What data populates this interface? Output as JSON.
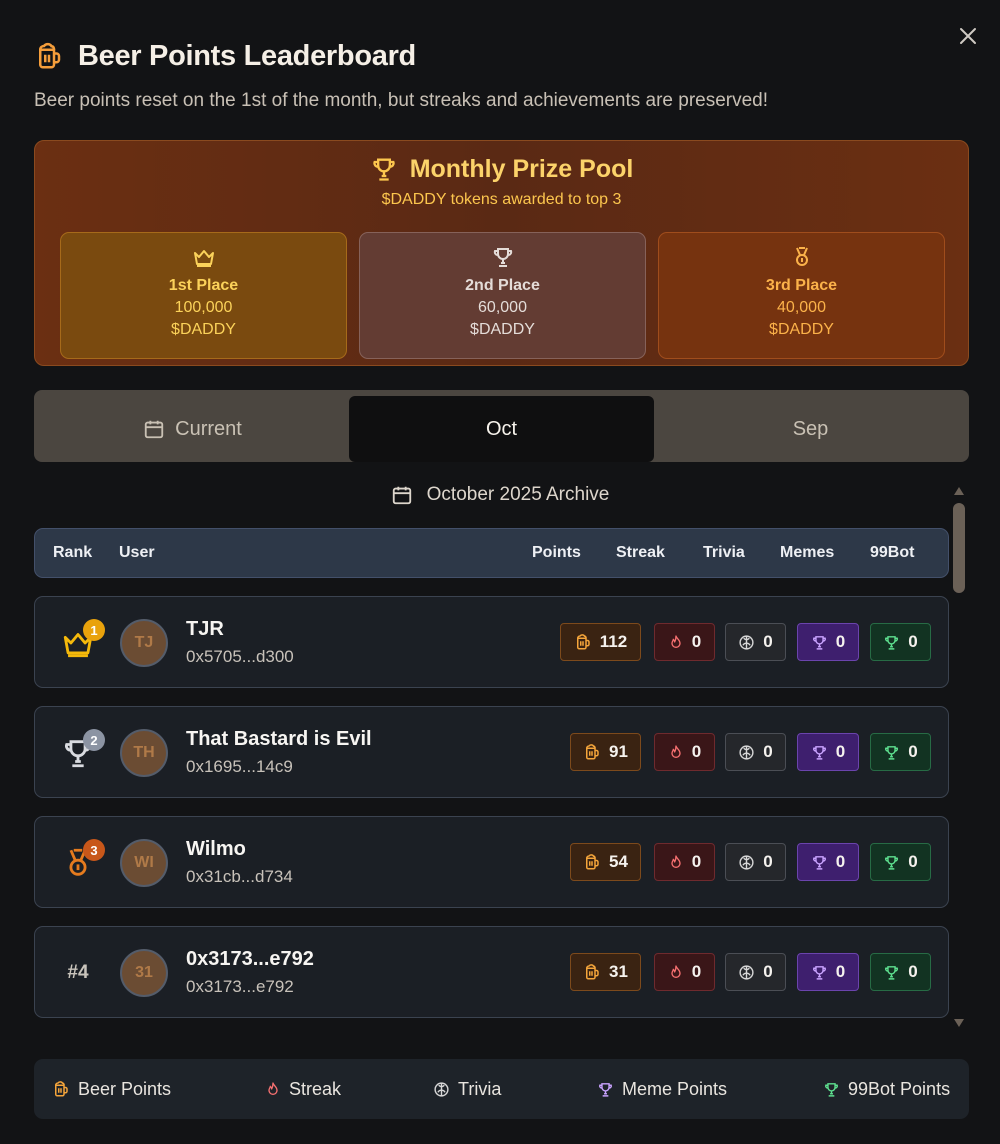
{
  "header": {
    "title": "Beer Points Leaderboard",
    "subtitle": "Beer points reset on the 1st of the month, but streaks and achievements are preserved!"
  },
  "prize_pool": {
    "title": "Monthly Prize Pool",
    "subtitle": "$DADDY tokens awarded to top 3",
    "places": [
      {
        "label": "1st Place",
        "amount": "100,000",
        "token": "$DADDY",
        "icon": "crown-icon"
      },
      {
        "label": "2nd Place",
        "amount": "60,000",
        "token": "$DADDY",
        "icon": "trophy-icon"
      },
      {
        "label": "3rd Place",
        "amount": "40,000",
        "token": "$DADDY",
        "icon": "medal-icon"
      }
    ]
  },
  "tabs": [
    {
      "label": "Current",
      "icon": "calendar-icon"
    },
    {
      "label": "Oct",
      "active": true
    },
    {
      "label": "Sep"
    }
  ],
  "archive_label": "October 2025 Archive",
  "table": {
    "columns": [
      "Rank",
      "User",
      "Points",
      "Streak",
      "Trivia",
      "Memes",
      "99Bot"
    ],
    "rows": [
      {
        "rank": "1",
        "initials": "TJ",
        "name": "TJR",
        "address": "0x5705...d300",
        "points": "112",
        "streak": "0",
        "trivia": "0",
        "memes": "0",
        "bot": "0"
      },
      {
        "rank": "2",
        "initials": "TH",
        "name": "That Bastard is Evil",
        "address": "0x1695...14c9",
        "points": "91",
        "streak": "0",
        "trivia": "0",
        "memes": "0",
        "bot": "0"
      },
      {
        "rank": "3",
        "initials": "WI",
        "name": "Wilmo",
        "address": "0x31cb...d734",
        "points": "54",
        "streak": "0",
        "trivia": "0",
        "memes": "0",
        "bot": "0"
      },
      {
        "rank": "#4",
        "initials": "31",
        "name": "0x3173...e792",
        "address": "0x3173...e792",
        "points": "31",
        "streak": "0",
        "trivia": "0",
        "memes": "0",
        "bot": "0"
      }
    ]
  },
  "legend": [
    {
      "label": "Beer Points",
      "icon": "beer-icon"
    },
    {
      "label": "Streak",
      "icon": "flame-icon"
    },
    {
      "label": "Trivia",
      "icon": "brain-icon"
    },
    {
      "label": "Meme Points",
      "icon": "trophy-icon"
    },
    {
      "label": "99Bot Points",
      "icon": "trophy-icon"
    }
  ],
  "colors": {
    "accent_orange": "#f59e3b",
    "prize_gold": "#fcd36a",
    "meme_purple": "#c9a3ff",
    "bot_green": "#5ee08f",
    "streak_red": "#f87171"
  }
}
